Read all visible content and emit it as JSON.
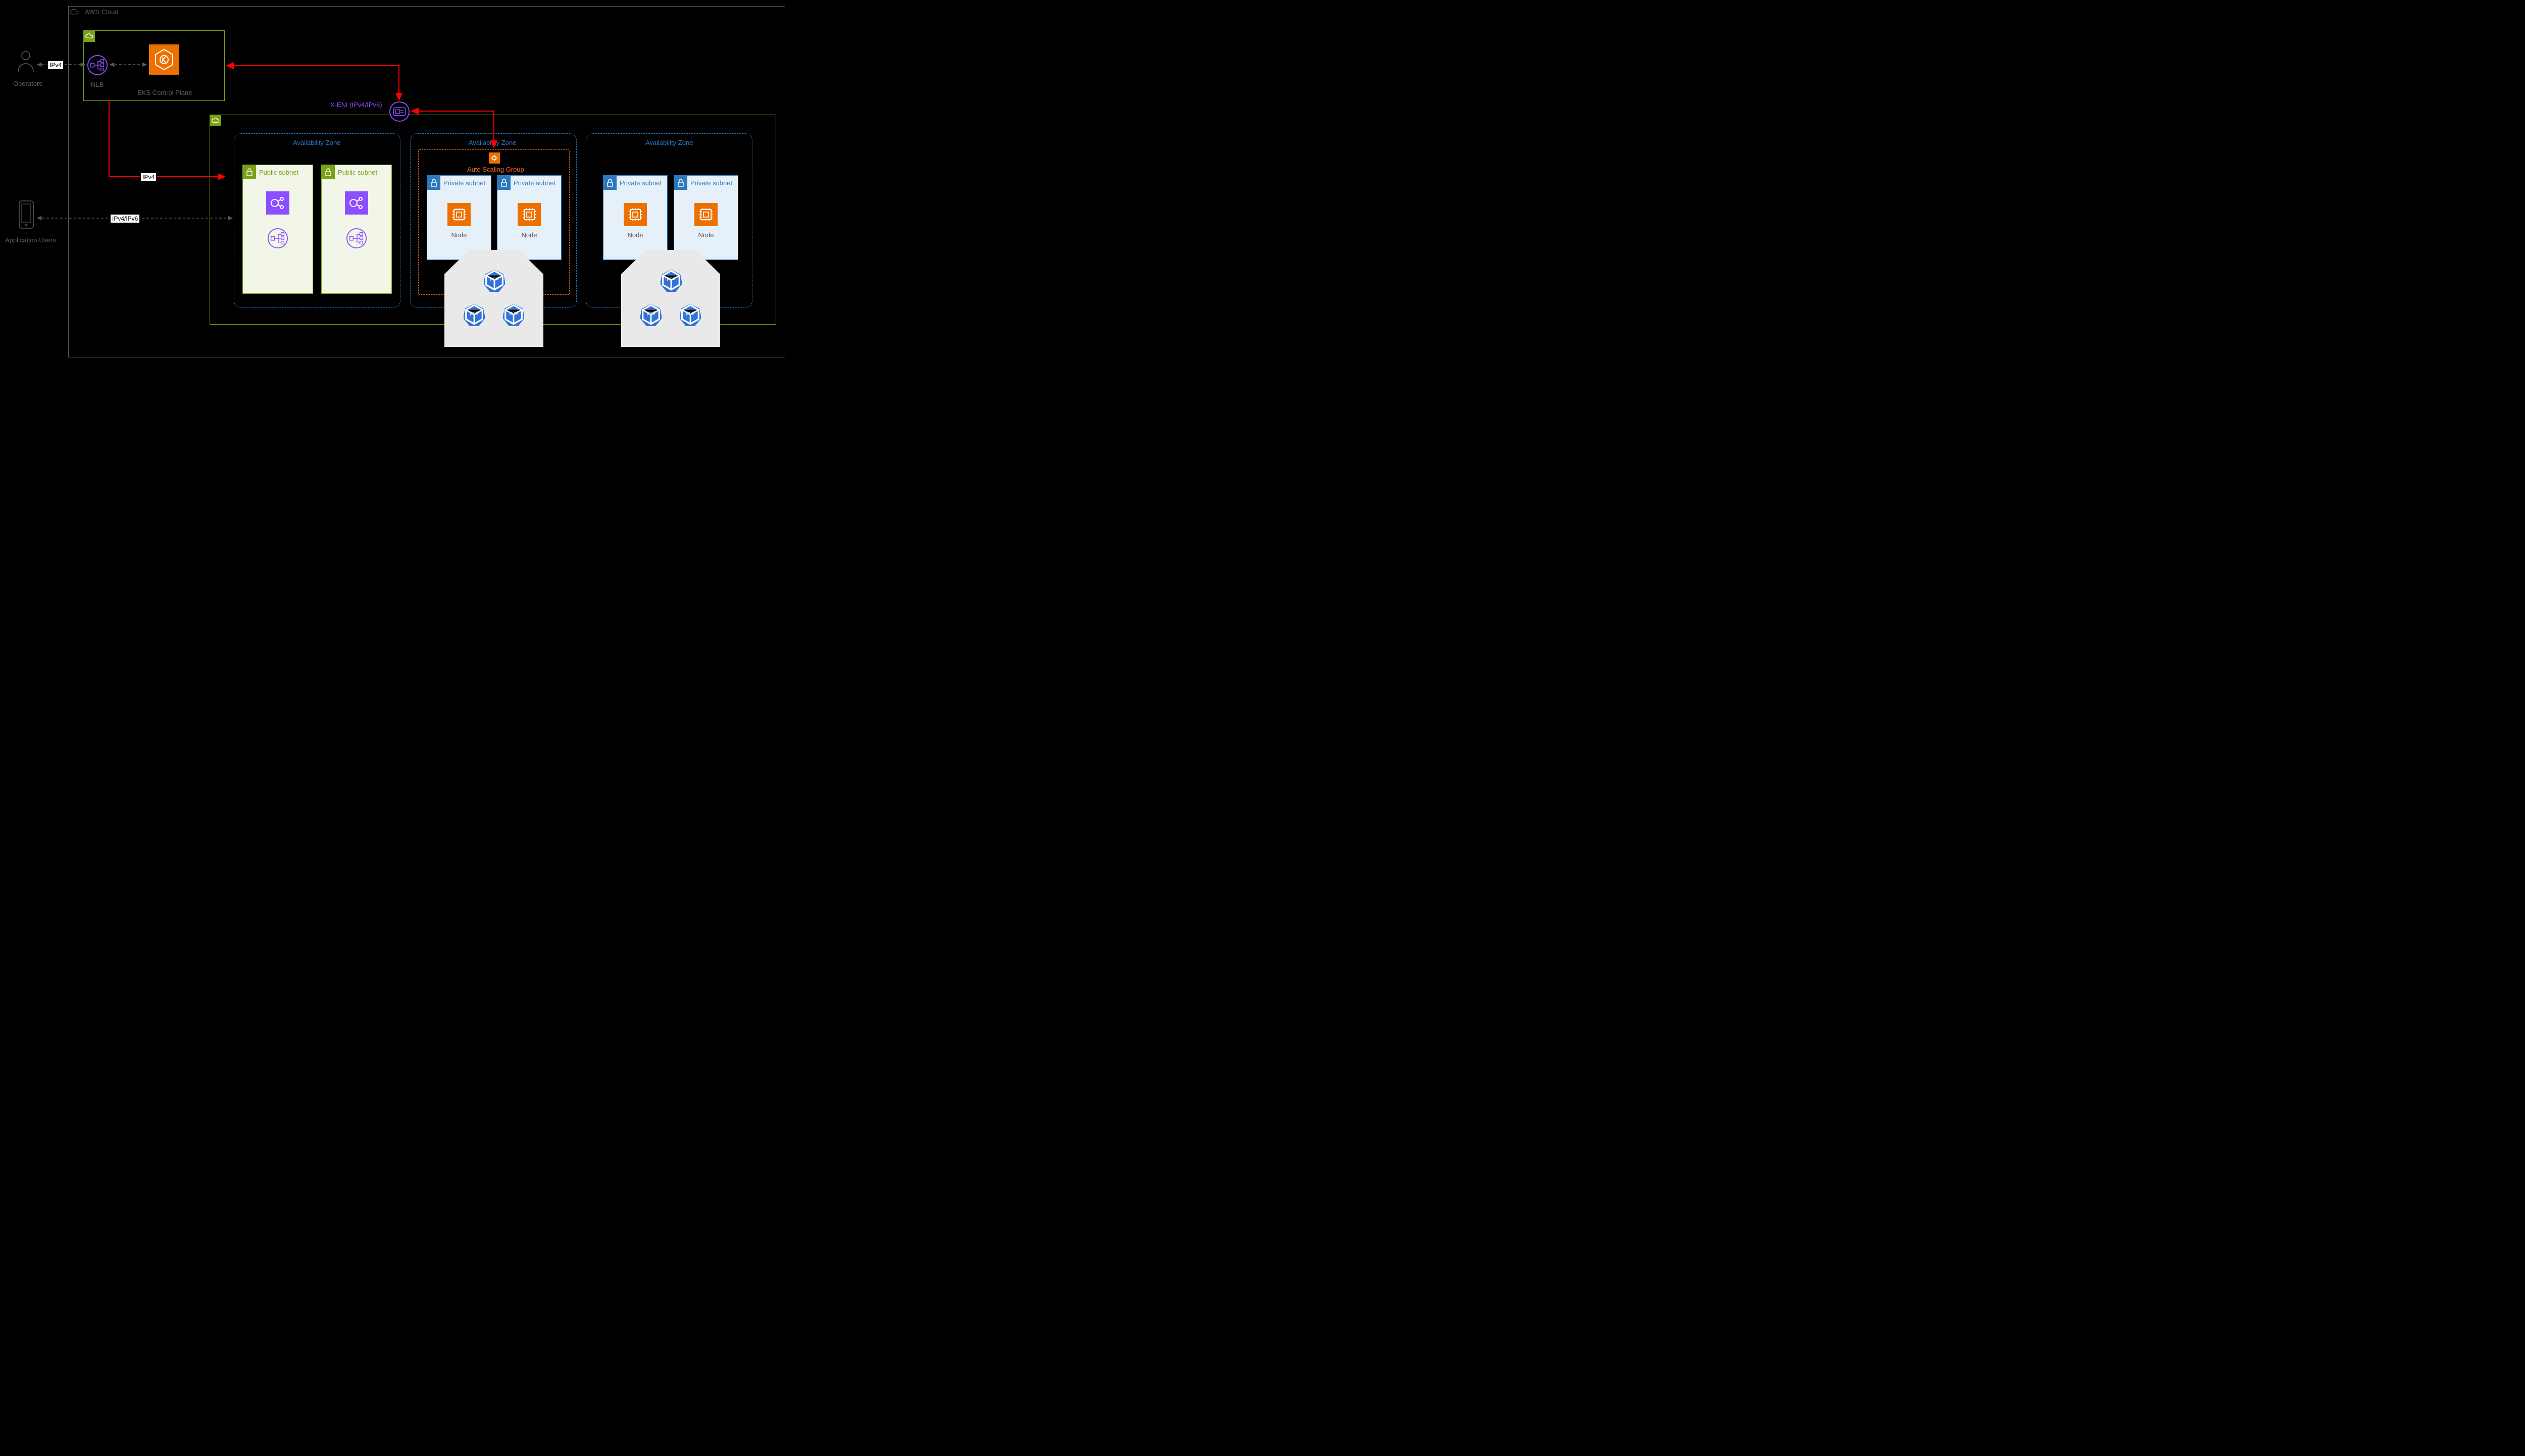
{
  "cloud": {
    "label": "AWS Cloud"
  },
  "operators": {
    "label": "Operators"
  },
  "appUsers": {
    "label": "Application Users"
  },
  "nlb": {
    "label": "NLB"
  },
  "eks": {
    "label": "EKS Control Plane"
  },
  "xeni": {
    "label": "X-ENI (IPv4/IPv6)"
  },
  "asg": {
    "label": "Auto Scaling Group"
  },
  "az": {
    "label": "Availability Zone"
  },
  "publicSubnet": {
    "label": "Public subnet"
  },
  "privateSubnet": {
    "label": "Private subnet"
  },
  "node": {
    "label": "Node"
  },
  "pod": {
    "label": "pod"
  },
  "conn": {
    "ipv4": "IPv4",
    "dual": "IPv4/IPv6"
  },
  "colors": {
    "cloudBorder": "#545b64",
    "greenBorder": "#7aa116",
    "greenFill": "#f2f6e8",
    "purple": "#8c4fff",
    "orange": "#ed7100",
    "azBorder": "#2c77bd",
    "asgBorder": "#e66e1f",
    "privateBorder": "#2c77bd",
    "privateFill": "#e6f0f8",
    "podGray": "#e9e9e9",
    "podHex": "#3173d6",
    "red": "#ff0000"
  }
}
